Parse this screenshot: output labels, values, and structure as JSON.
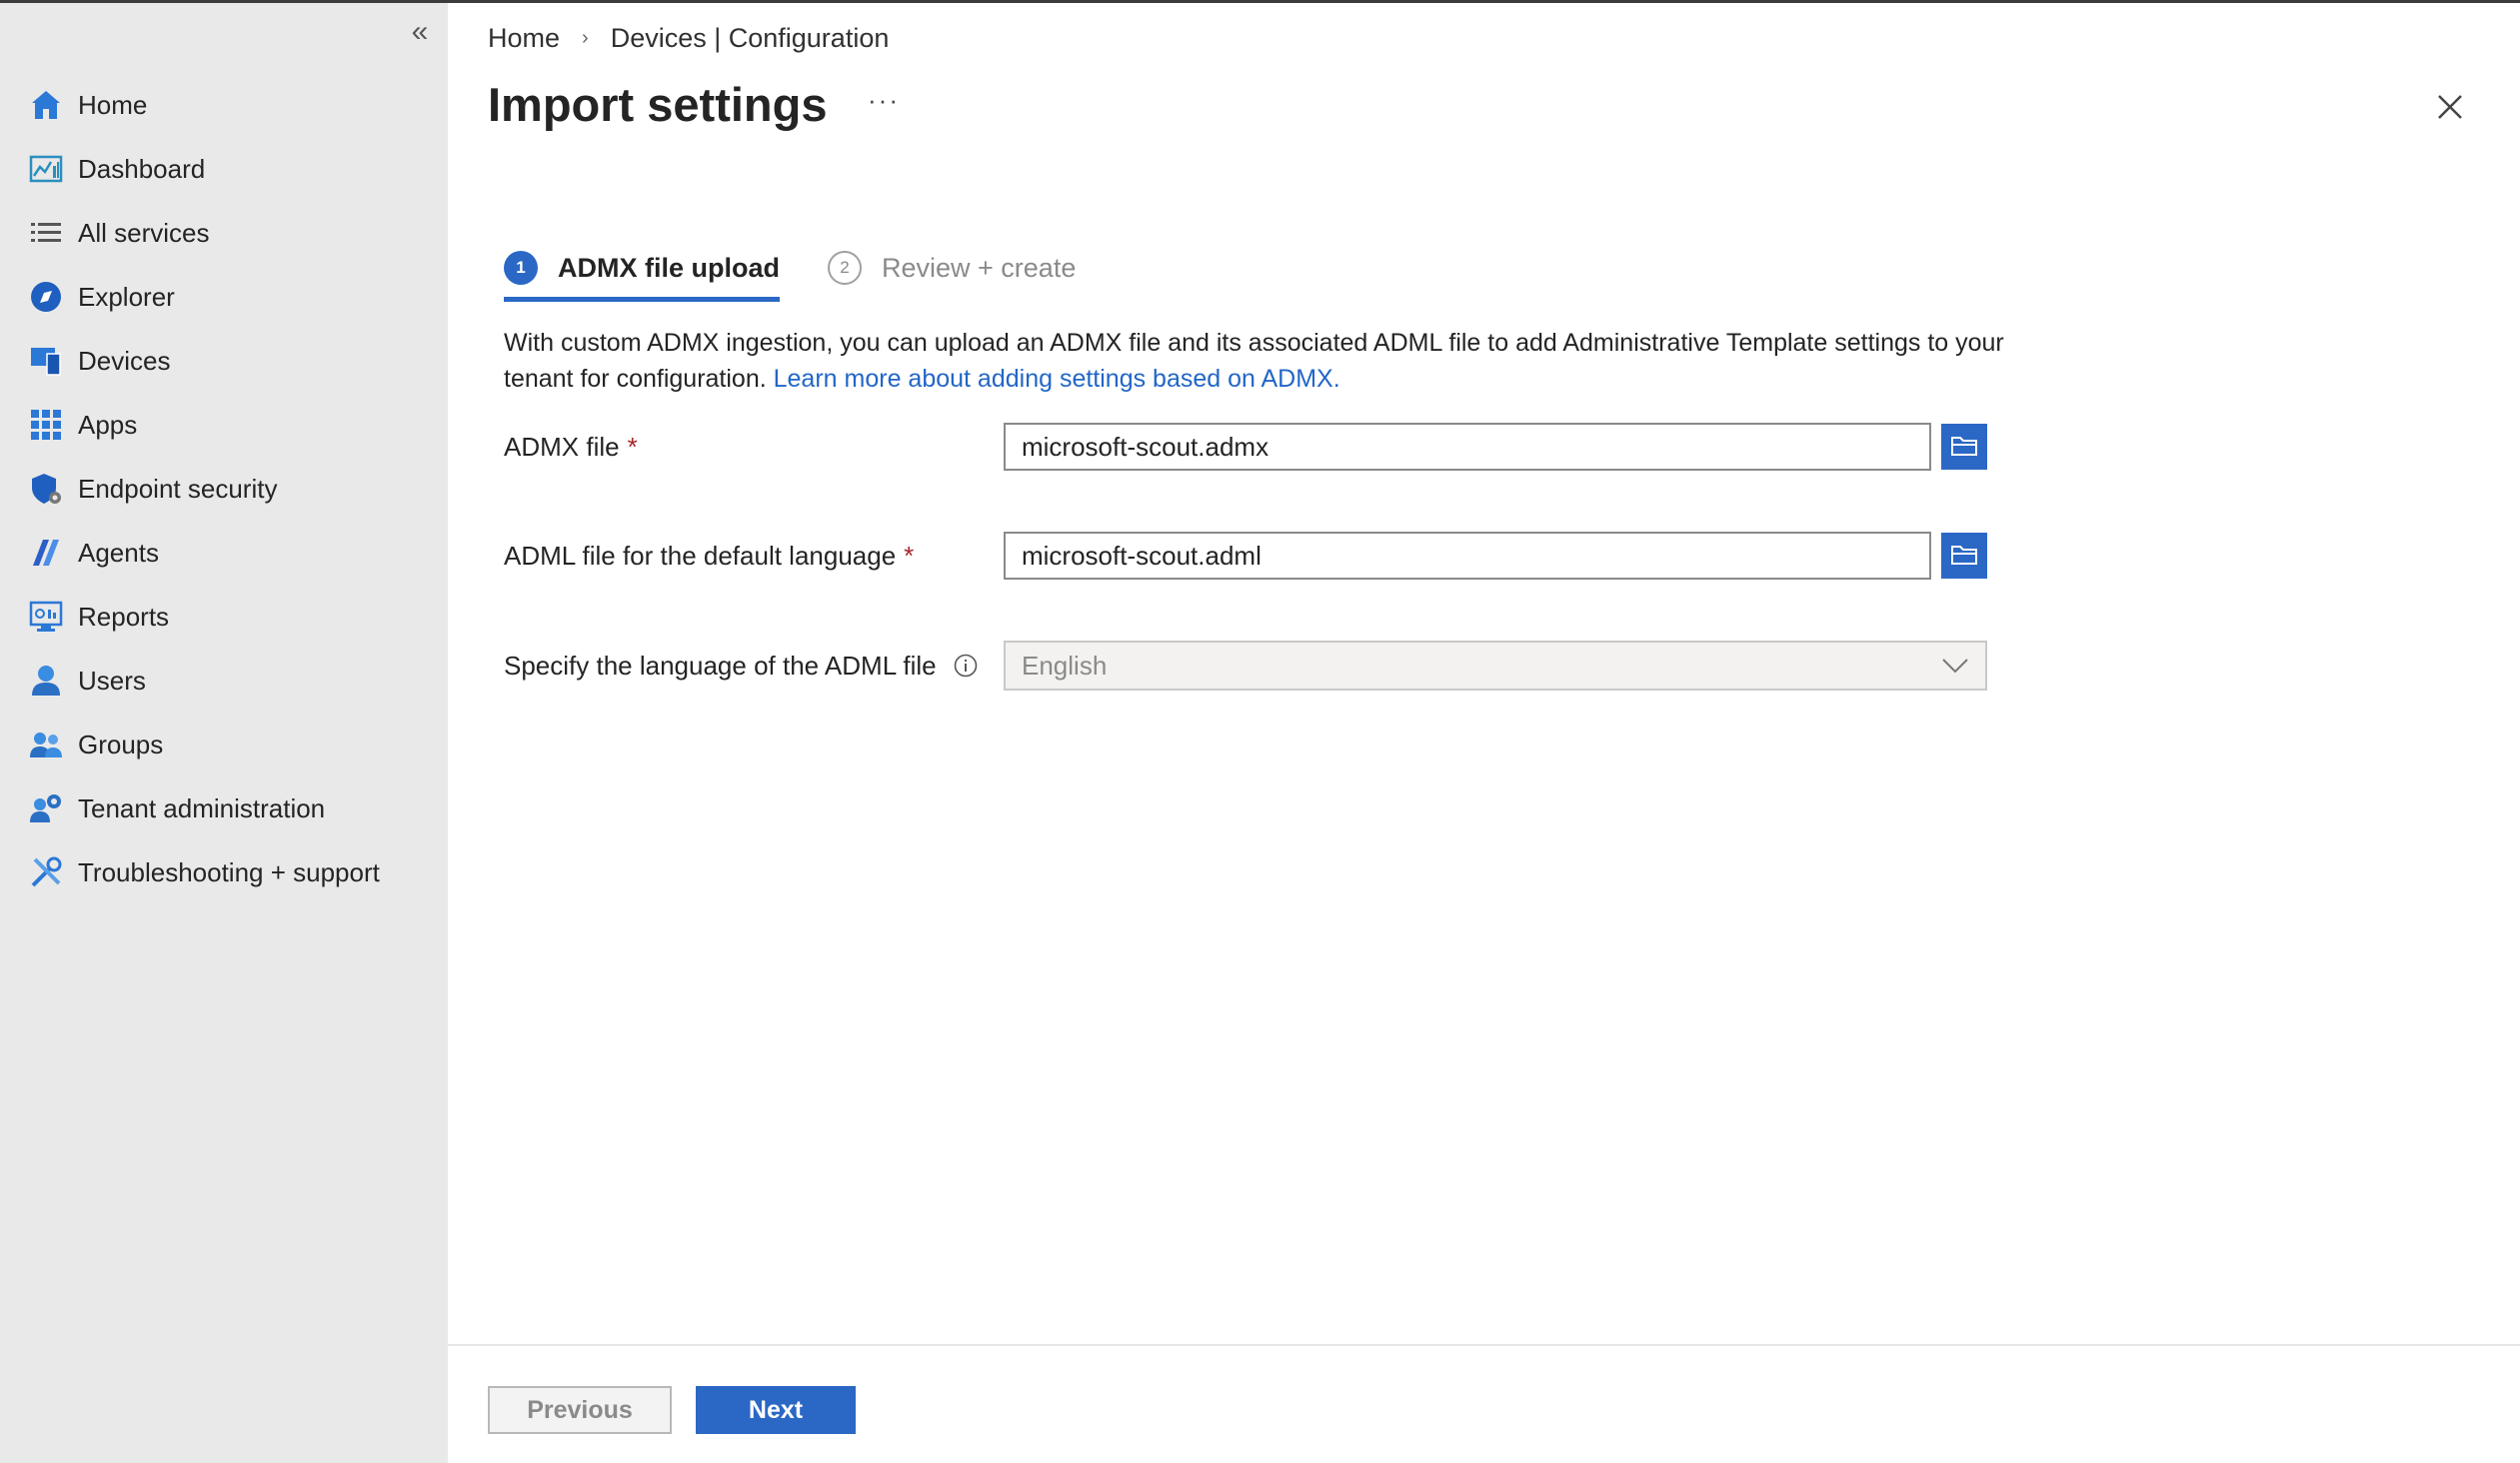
{
  "sidebar": {
    "collapse_glyph": "«",
    "items": [
      {
        "label": "Home",
        "icon": "home-icon"
      },
      {
        "label": "Dashboard",
        "icon": "dashboard-icon"
      },
      {
        "label": "All services",
        "icon": "list-icon"
      },
      {
        "label": "Explorer",
        "icon": "explorer-icon"
      },
      {
        "label": "Devices",
        "icon": "devices-icon"
      },
      {
        "label": "Apps",
        "icon": "apps-grid-icon"
      },
      {
        "label": "Endpoint security",
        "icon": "shield-icon"
      },
      {
        "label": "Agents",
        "icon": "agents-icon"
      },
      {
        "label": "Reports",
        "icon": "reports-icon"
      },
      {
        "label": "Users",
        "icon": "user-icon"
      },
      {
        "label": "Groups",
        "icon": "groups-icon"
      },
      {
        "label": "Tenant administration",
        "icon": "tenant-admin-icon"
      },
      {
        "label": "Troubleshooting + support",
        "icon": "tools-icon"
      }
    ]
  },
  "breadcrumb": {
    "items": [
      "Home",
      "Devices | Configuration"
    ],
    "separator": "›"
  },
  "page": {
    "title": "Import settings",
    "more": "···"
  },
  "steps": [
    {
      "number": "1",
      "label": "ADMX file upload",
      "state": "active"
    },
    {
      "number": "2",
      "label": "Review + create",
      "state": "inactive"
    }
  ],
  "description": {
    "text": "With custom ADMX ingestion, you can upload an ADMX file and its associated ADML file to add Administrative Template settings to your tenant for configuration. ",
    "link": "Learn more about adding settings based on ADMX."
  },
  "form": {
    "admx": {
      "label": "ADMX file",
      "required": "*",
      "value": "microsoft-scout.admx"
    },
    "adml": {
      "label": "ADML file for the default language",
      "required": "*",
      "value": "microsoft-scout.adml"
    },
    "language": {
      "label": "Specify the language of the ADML file",
      "value": "English"
    }
  },
  "footer": {
    "previous": "Previous",
    "next": "Next"
  },
  "colors": {
    "accent": "#2b68c5",
    "link": "#2266c7",
    "required": "#a4262c",
    "sidebar_bg": "#e9e9e9"
  }
}
